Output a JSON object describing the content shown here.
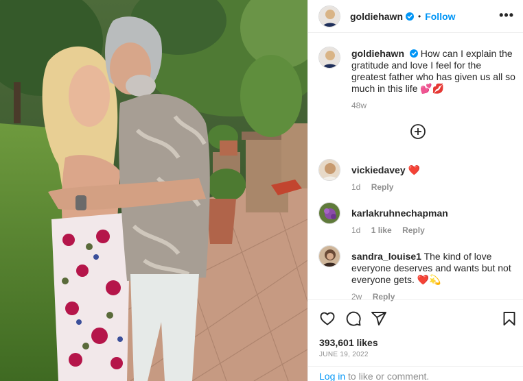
{
  "post": {
    "author": "goldiehawn",
    "follow_label": "Follow",
    "separator": "•",
    "more_label": "•••"
  },
  "caption": {
    "username": "goldiehawn",
    "text": "How can I explain the gratitude and love I feel for the greatest father who has given us all so much in this life 💕💋",
    "time": "48w"
  },
  "comments": [
    {
      "username": "vickiedavey",
      "text": "❤️",
      "time": "1d",
      "likes": "",
      "reply_label": "Reply"
    },
    {
      "username": "karlakruhnechapman",
      "text": "",
      "time": "1d",
      "likes": "1 like",
      "reply_label": "Reply"
    },
    {
      "username": "sandra_louise1",
      "text": "The kind of love everyone deserves and wants but not everyone gets. ❤️💫",
      "time": "2w",
      "likes": "",
      "reply_label": "Reply"
    }
  ],
  "footer": {
    "likes": "393,601 likes",
    "date": "JUNE 19, 2022",
    "login_link": "Log in",
    "login_rest": " to like or comment."
  },
  "icons": {
    "header": [
      "avatar",
      "verified-badge-icon",
      "more-options-icon"
    ],
    "actions": [
      "heart-icon",
      "comment-icon",
      "share-icon",
      "bookmark-icon"
    ],
    "load_more": "plus-circle-icon"
  },
  "colors": {
    "accent": "#0095f6",
    "text": "#262626",
    "muted": "#8e8e8e",
    "border": "#efefef"
  }
}
